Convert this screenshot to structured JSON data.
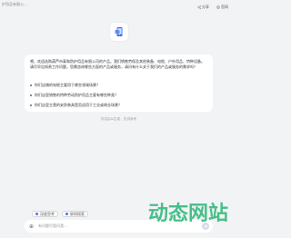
{
  "window": {
    "title": "护用品有限公..."
  },
  "header": {
    "actions": [
      {
        "label": "分享",
        "icon": "share-icon"
      },
      {
        "label": "官网",
        "icon": "globe-icon"
      }
    ]
  },
  "chat": {
    "intro": "喂，欢迎选购葫芦市泰和防护用品有限公司的产品。我们销售劳保及其他装备、电缆、户外用品、特种设备。请尽早告知贵工作问题，您需咨询哪些方面的产品或服务，请问有什么关于我们的产品或服务的需求吗？",
    "suggested_questions": [
      "你们店铺的电缆主要用于哪些领域场景？",
      "你们店里销售的特种劳动防护用品主要有哪些种类？",
      "你们店里主营的安防装具是否适用于工业或商业场景？"
    ],
    "generated_note": "内容由AI生成，仅供参考"
  },
  "input": {
    "tags": [
      {
        "label": "深度思考",
        "icon_color": "#5b7cff"
      },
      {
        "label": "联网搜索",
        "icon_color": "#5b7cff"
      }
    ],
    "placeholder": "有问题尽管问我..."
  },
  "watermark": {
    "text": "动态网站",
    "color": "#29b574"
  }
}
